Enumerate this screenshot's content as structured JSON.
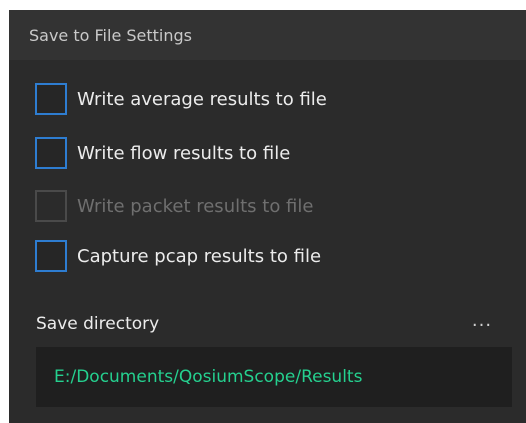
{
  "panel": {
    "title": "Save to File Settings"
  },
  "options": [
    {
      "label": "Write average results to file",
      "checked": false,
      "enabled": true
    },
    {
      "label": "Write flow results to file",
      "checked": false,
      "enabled": true
    },
    {
      "label": "Write packet results to file",
      "checked": false,
      "enabled": false
    },
    {
      "label": "Capture pcap results to file",
      "checked": false,
      "enabled": true
    }
  ],
  "save_directory": {
    "label": "Save directory",
    "browse_label": "...",
    "path": "E:/Documents/QosiumScope/Results"
  },
  "colors": {
    "panel_bg": "#2b2b2b",
    "header_bg": "#333333",
    "checkbox_border": "#2e7dd1",
    "path_text": "#25d08f",
    "disabled_text": "#6f6f6f"
  }
}
